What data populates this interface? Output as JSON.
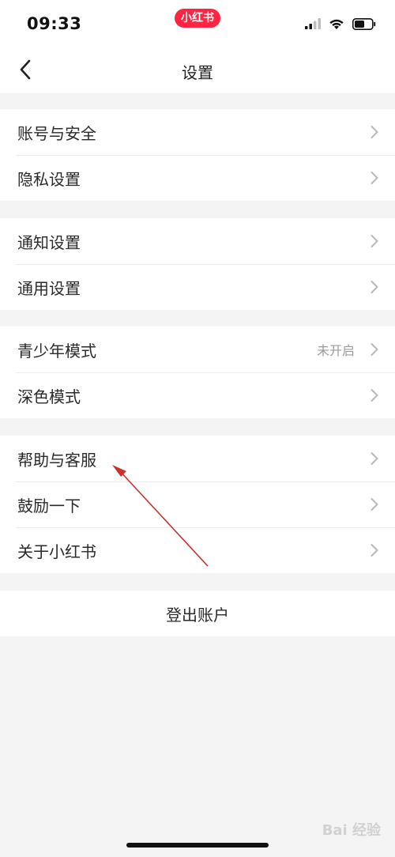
{
  "status_bar": {
    "time": "09:33",
    "app_badge": "小红书",
    "icons": [
      "signal-icon",
      "wifi-icon",
      "battery-icon"
    ]
  },
  "nav": {
    "title": "设置",
    "back_icon": "chevron-left-icon"
  },
  "sections": [
    {
      "items": [
        {
          "label": "账号与安全"
        },
        {
          "label": "隐私设置"
        }
      ]
    },
    {
      "items": [
        {
          "label": "通知设置"
        },
        {
          "label": "通用设置"
        }
      ]
    },
    {
      "items": [
        {
          "label": "青少年模式",
          "value": "未开启"
        },
        {
          "label": "深色模式"
        }
      ]
    },
    {
      "items": [
        {
          "label": "帮助与客服"
        },
        {
          "label": "鼓励一下"
        },
        {
          "label": "关于小红书"
        }
      ]
    }
  ],
  "logout": {
    "label": "登出账户"
  },
  "watermark": "Bai 经验",
  "colors": {
    "brand_red": "#ff2442",
    "page_bg": "#f4f4f4",
    "card_bg": "#ffffff",
    "annotation_arrow": "#c8332f"
  }
}
